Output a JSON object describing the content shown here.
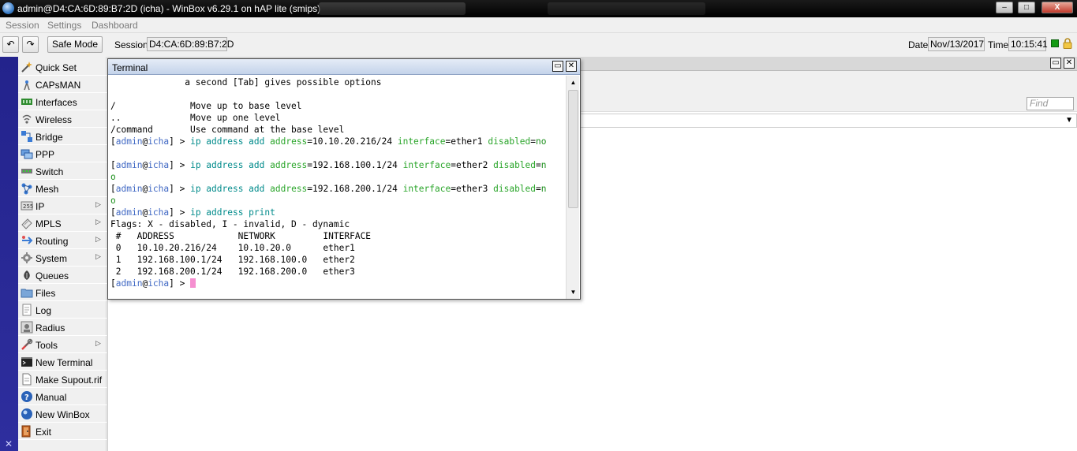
{
  "window": {
    "title": "admin@D4:CA:6D:89:B7:2D (icha) - WinBox v6.29.1 on hAP lite (smips)",
    "minimize": "–",
    "maximize": "□",
    "close": "X"
  },
  "menu": [
    "Session",
    "Settings",
    "Dashboard"
  ],
  "toolbar": {
    "undo": "↶",
    "redo": "↷",
    "safe_mode": "Safe Mode",
    "session_label": "Session:",
    "session_value": "D4:CA:6D:89:B7:2D",
    "date_label": "Date:",
    "date_value": "Nov/13/2017",
    "time_label": "Time:",
    "time_value": "10:15:41",
    "status_color": "#129a12"
  },
  "sidebar": {
    "strip_label": "✕",
    "items": [
      {
        "label": "Quick Set",
        "icon": "wand-icon",
        "submenu": false
      },
      {
        "label": "CAPsMAN",
        "icon": "antenna-icon",
        "submenu": false
      },
      {
        "label": "Interfaces",
        "icon": "interfaces-icon",
        "submenu": false
      },
      {
        "label": "Wireless",
        "icon": "wireless-icon",
        "submenu": false
      },
      {
        "label": "Bridge",
        "icon": "bridge-icon",
        "submenu": false
      },
      {
        "label": "PPP",
        "icon": "ppp-icon",
        "submenu": false
      },
      {
        "label": "Switch",
        "icon": "switch-icon",
        "submenu": false
      },
      {
        "label": "Mesh",
        "icon": "mesh-icon",
        "submenu": false
      },
      {
        "label": "IP",
        "icon": "ip-icon",
        "submenu": true
      },
      {
        "label": "MPLS",
        "icon": "mpls-icon",
        "submenu": true
      },
      {
        "label": "Routing",
        "icon": "routing-icon",
        "submenu": true
      },
      {
        "label": "System",
        "icon": "gear-icon",
        "submenu": true
      },
      {
        "label": "Queues",
        "icon": "queues-icon",
        "submenu": false
      },
      {
        "label": "Files",
        "icon": "folder-icon",
        "submenu": false
      },
      {
        "label": "Log",
        "icon": "log-icon",
        "submenu": false
      },
      {
        "label": "Radius",
        "icon": "radius-icon",
        "submenu": false
      },
      {
        "label": "Tools",
        "icon": "tools-icon",
        "submenu": true
      },
      {
        "label": "New Terminal",
        "icon": "terminal-icon",
        "submenu": false
      },
      {
        "label": "Make Supout.rif",
        "icon": "document-icon",
        "submenu": false
      },
      {
        "label": "Manual",
        "icon": "help-icon",
        "submenu": false
      },
      {
        "label": "New WinBox",
        "icon": "winbox-icon",
        "submenu": false
      },
      {
        "label": "Exit",
        "icon": "exit-icon",
        "submenu": false
      }
    ]
  },
  "workspace": {
    "find_placeholder": "Find"
  },
  "terminal": {
    "title": "Terminal",
    "prompt_user": "admin",
    "prompt_host": "icha",
    "help_lines": [
      "              a second [Tab] gives possible options",
      "",
      "/              Move up to base level",
      "..             Move up one level",
      "/command       Use command at the base level"
    ],
    "commands": [
      {
        "path": "ip address add",
        "args": [
          {
            "key": "address",
            "value": "10.10.20.216/24"
          },
          {
            "key": "interface",
            "value": "ether1"
          },
          {
            "key": "disabled",
            "value": "no"
          }
        ],
        "wrap": ""
      },
      {
        "path": "ip address add",
        "args": [
          {
            "key": "address",
            "value": "192.168.100.1/24"
          },
          {
            "key": "interface",
            "value": "ether2"
          },
          {
            "key": "disabled",
            "value": "n"
          }
        ],
        "wrap": "o"
      },
      {
        "path": "ip address add",
        "args": [
          {
            "key": "address",
            "value": "192.168.200.1/24"
          },
          {
            "key": "interface",
            "value": "ether3"
          },
          {
            "key": "disabled",
            "value": "n"
          }
        ],
        "wrap": "o"
      }
    ],
    "print_command": "ip address print",
    "flags": "Flags: X - disabled, I - invalid, D - dynamic",
    "table_header": " #   ADDRESS            NETWORK         INTERFACE",
    "table_rows": [
      " 0   10.10.20.216/24    10.10.20.0      ether1",
      " 1   192.168.100.1/24   192.168.100.0   ether2",
      " 2   192.168.200.1/24   192.168.200.0   ether3"
    ]
  }
}
